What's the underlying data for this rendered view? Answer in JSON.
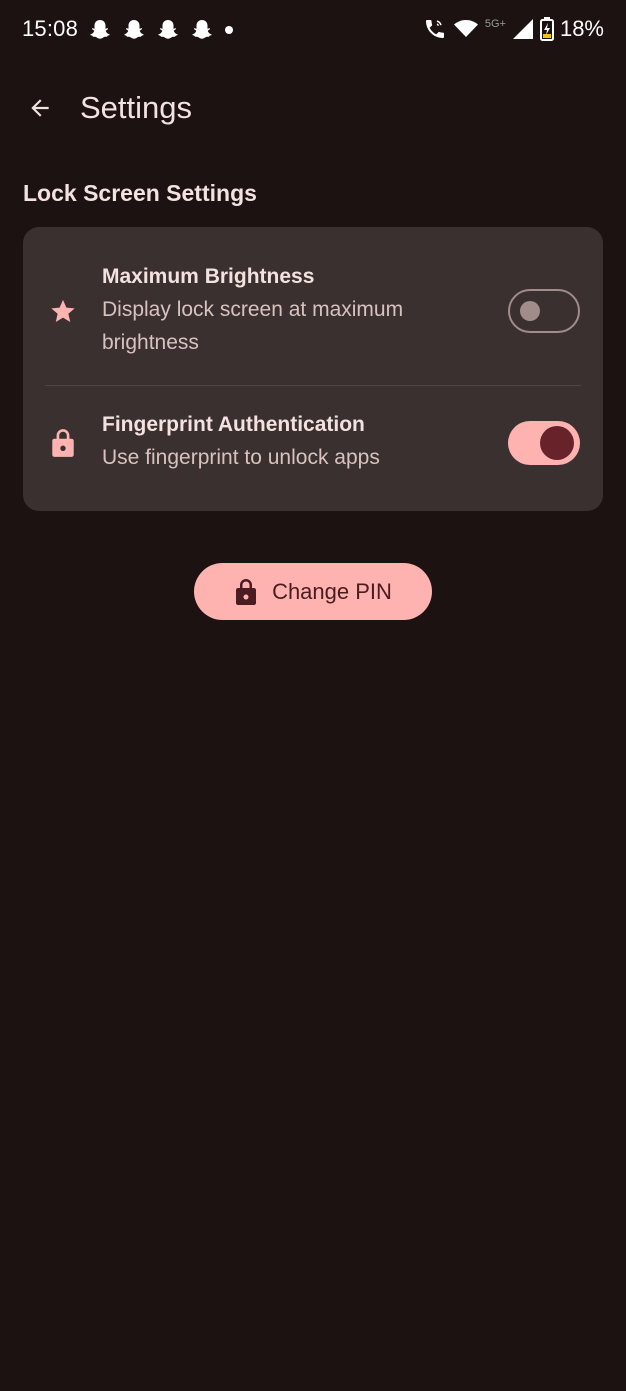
{
  "status_bar": {
    "time": "15:08",
    "notification_icons": [
      "snapchat-icon",
      "snapchat-icon",
      "snapchat-icon",
      "snapchat-icon",
      "dot-icon"
    ],
    "network_label": "5G+",
    "battery_percent": "18%",
    "icons": [
      "wifi-calling-icon",
      "wifi-icon",
      "cell-signal-icon",
      "battery-charging-icon"
    ]
  },
  "top_bar": {
    "title": "Settings",
    "back_icon": "arrow-back-icon"
  },
  "section": {
    "title": "Lock Screen Settings"
  },
  "settings": [
    {
      "icon": "star-icon",
      "title": "Maximum Brightness",
      "subtitle": "Display lock screen at maximum brightness",
      "enabled": false
    },
    {
      "icon": "lock-icon",
      "title": "Fingerprint Authentication",
      "subtitle": "Use fingerprint to unlock apps",
      "enabled": true
    }
  ],
  "change_pin_button": {
    "label": "Change PIN",
    "icon": "lock-icon"
  },
  "colors": {
    "background": "#1b1211",
    "card": "#3a302f",
    "accent": "#ffb3b0",
    "accent_on": "#67222a",
    "text_primary": "#f3e2e0",
    "text_secondary": "#d8c2bf"
  }
}
